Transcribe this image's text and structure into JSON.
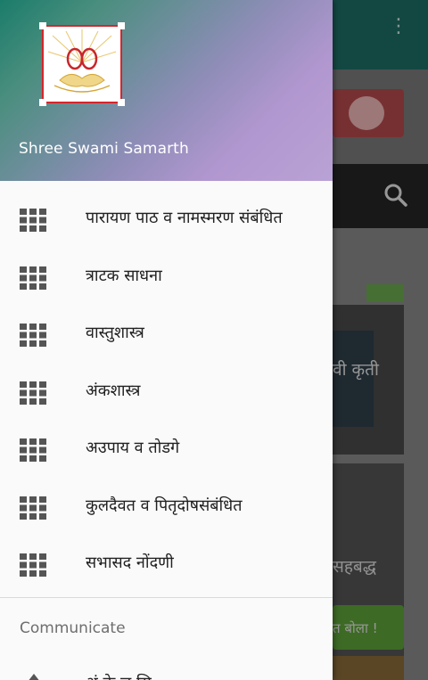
{
  "background_app": {
    "banner_text_1": "वी कृती",
    "banner_text_2": "सहबद्ध",
    "button_text": "त बोला !"
  },
  "drawer": {
    "profile_name": "Shree Swami Samarth",
    "items": [
      {
        "label": "पारायण पाठ व नामस्मरण संबंधित",
        "icon": "grid-icon"
      },
      {
        "label": "त्राटक साधना",
        "icon": "grid-icon"
      },
      {
        "label": "वास्तुशास्त्र",
        "icon": "grid-icon"
      },
      {
        "label": "अंकशास्त्र",
        "icon": "grid-icon"
      },
      {
        "label": "अउपाय व तोडगे",
        "icon": "grid-icon"
      },
      {
        "label": "कुलदैवत व पितृदोषसंबंधित",
        "icon": "grid-icon"
      },
      {
        "label": "सभासद नोंदणी",
        "icon": "grid-icon"
      }
    ],
    "communicate": {
      "title": "Communicate",
      "items": [
        {
          "label": "अं के ल सि",
          "icon": "share-icon"
        }
      ]
    }
  },
  "colors": {
    "toolbar": "#1e6f66",
    "logo_border": "#d5262c",
    "icon_gray": "#555555"
  }
}
